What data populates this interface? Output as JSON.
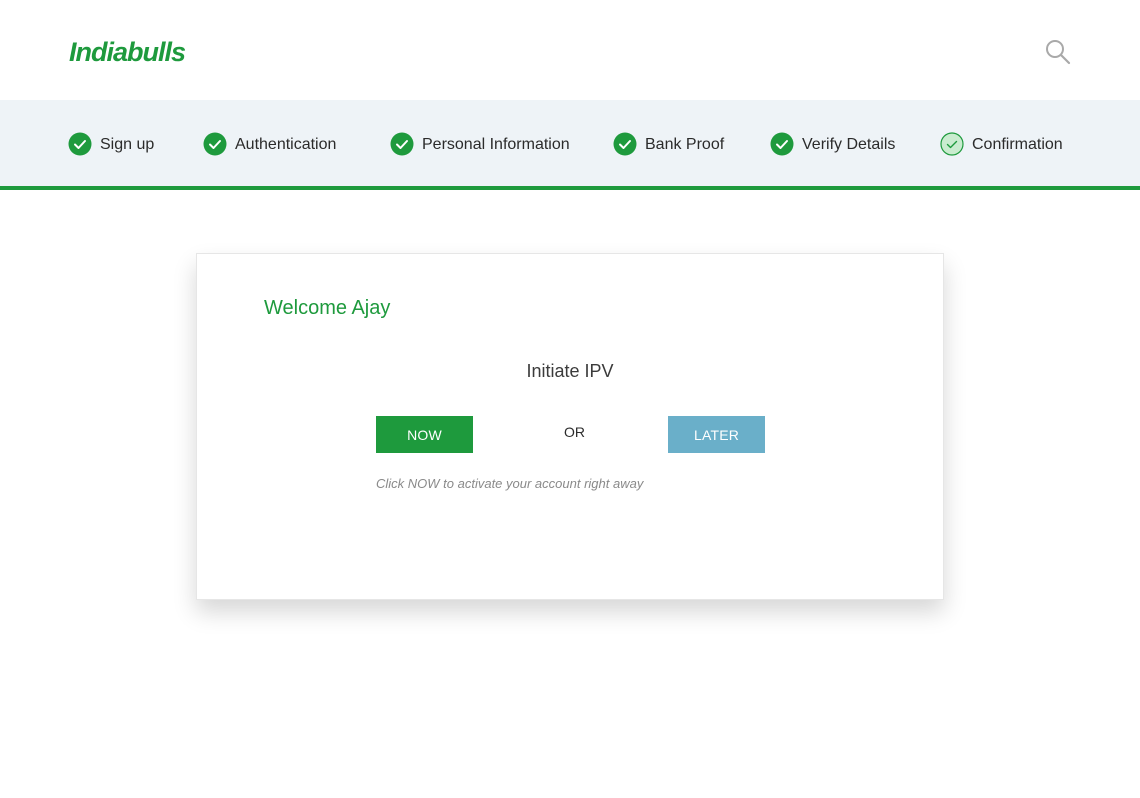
{
  "header": {
    "logo_text": "Indiabulls",
    "search_icon": "search-icon"
  },
  "colors": {
    "brand_green": "#1e9a3d",
    "later_blue": "#6aafc9",
    "stepper_bg": "#eef3f7",
    "hint_gray": "#8a8a8a"
  },
  "steps": [
    {
      "label": "Sign up",
      "status": "completed",
      "icon": "check-circle-icon"
    },
    {
      "label": "Authentication",
      "status": "completed",
      "icon": "check-circle-icon"
    },
    {
      "label": "Personal Information",
      "status": "completed",
      "icon": "check-circle-icon"
    },
    {
      "label": "Bank Proof",
      "status": "completed",
      "icon": "check-circle-icon"
    },
    {
      "label": "Verify Details",
      "status": "completed",
      "icon": "check-circle-icon"
    },
    {
      "label": "Confirmation",
      "status": "current",
      "icon": "check-circle-outline-icon"
    }
  ],
  "card": {
    "welcome": "Welcome Ajay",
    "title": "Initiate IPV",
    "now_label": "NOW",
    "or_label": "OR",
    "later_label": "LATER",
    "hint": "Click NOW to activate your account right away"
  }
}
